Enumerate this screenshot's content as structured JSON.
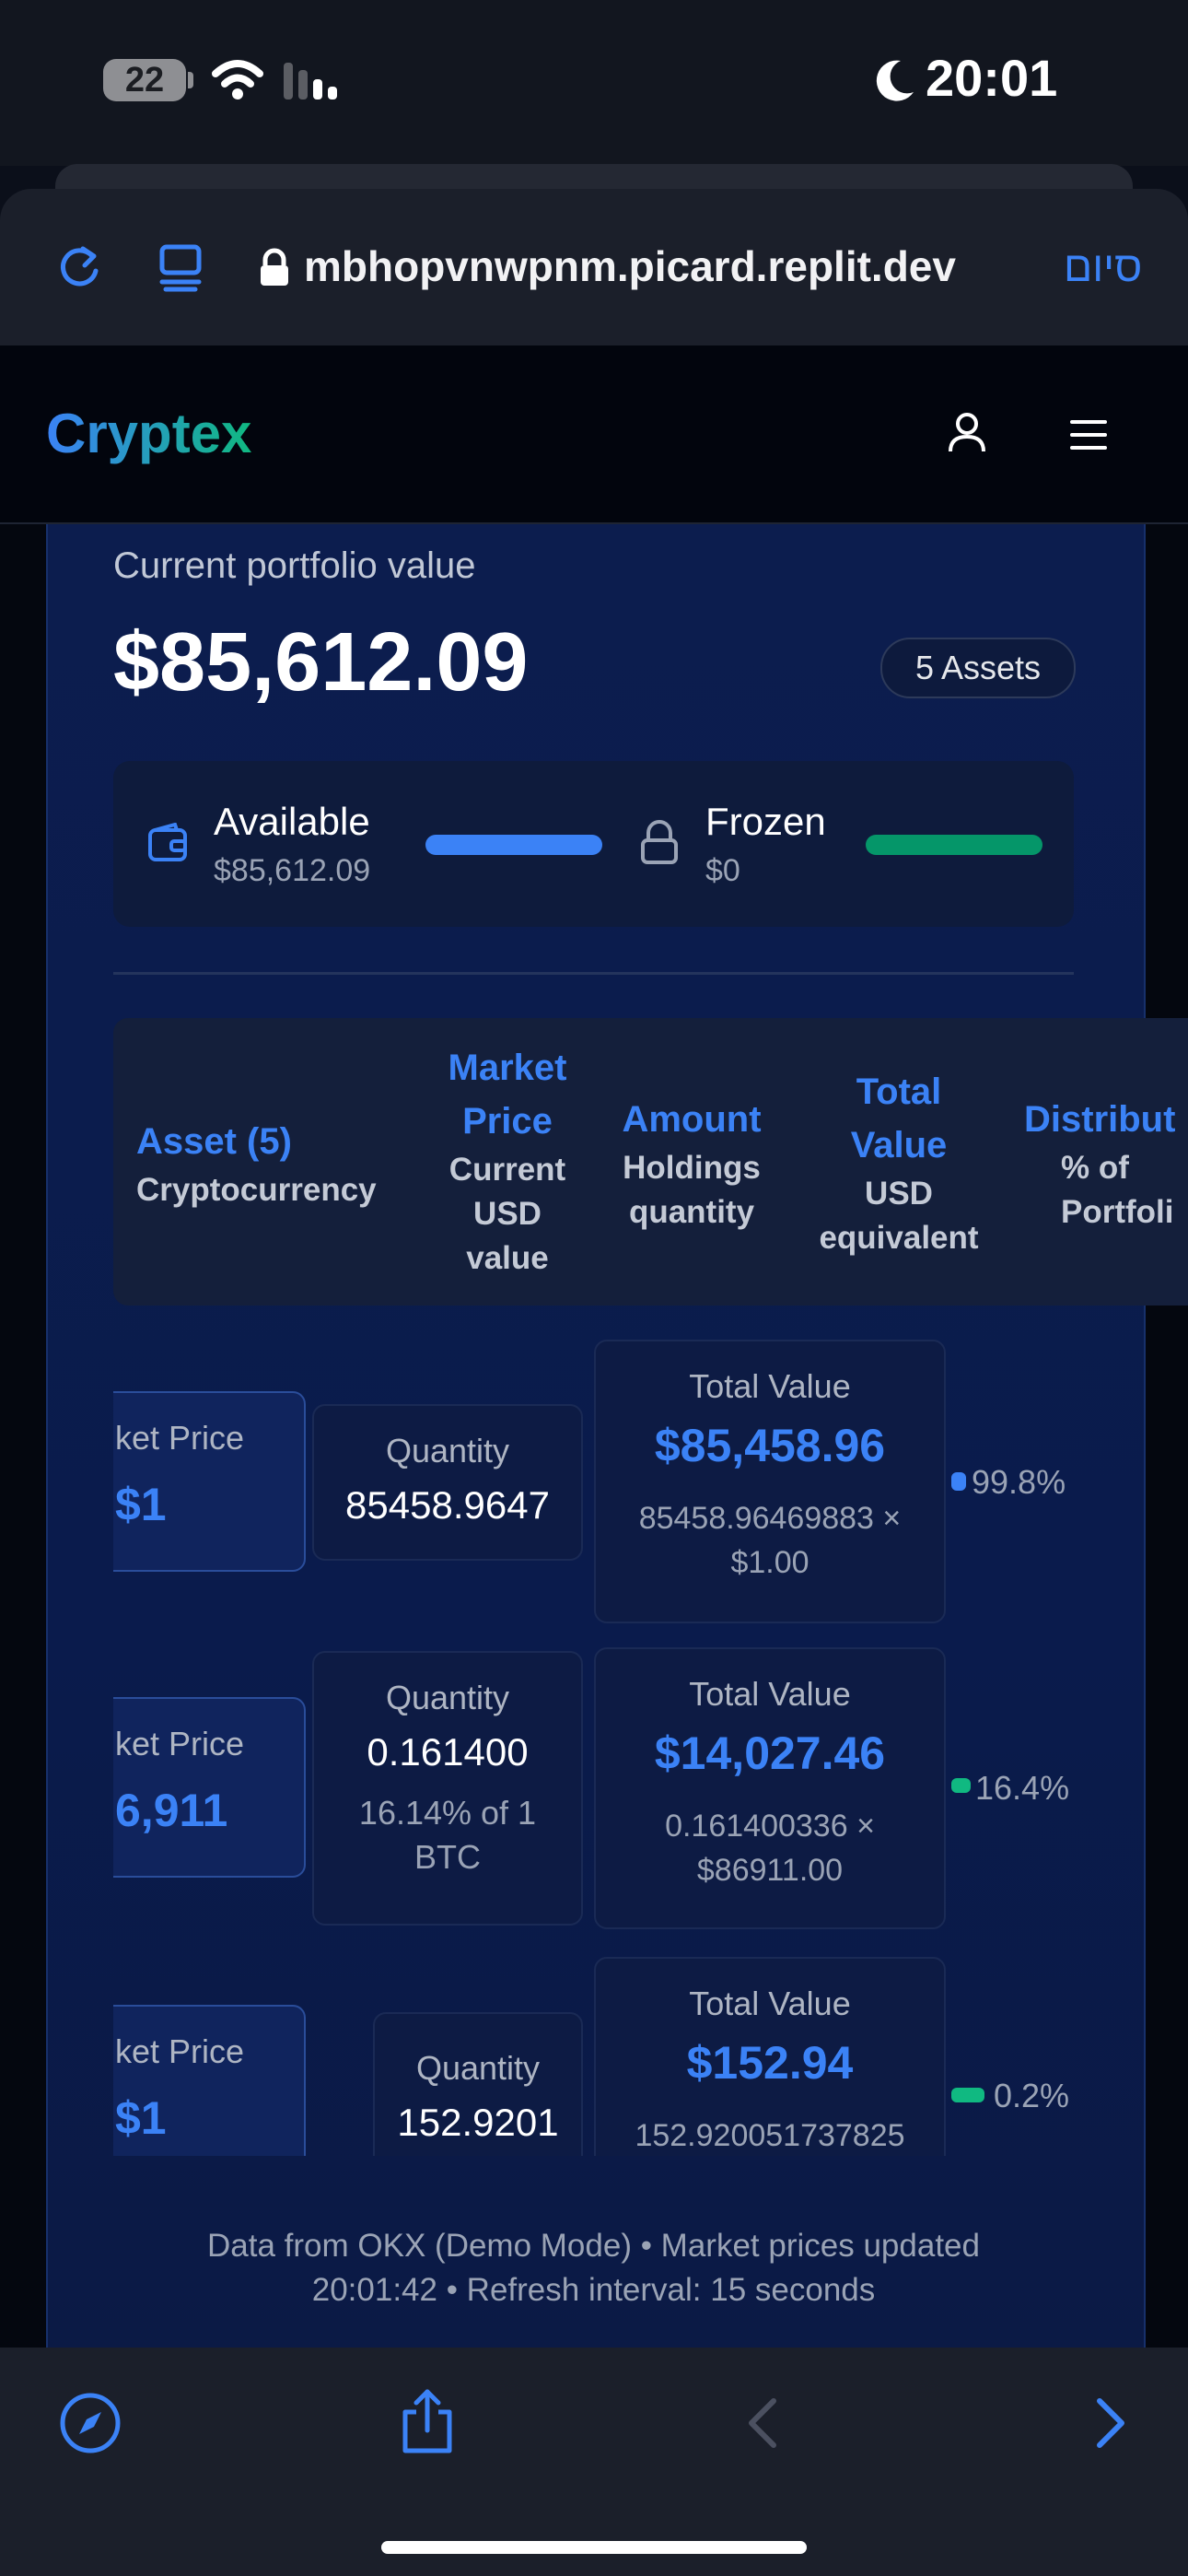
{
  "status_bar": {
    "battery": "22",
    "time": "20:01"
  },
  "browser": {
    "url": "mbhopvnwpnm.picard.replit.dev",
    "done_label": "סיום"
  },
  "app": {
    "logo": "Cryptex"
  },
  "portfolio": {
    "label": "Current portfolio value",
    "value": "$85,612.09",
    "assets_badge": "5 Assets",
    "available": {
      "title": "Available",
      "amount": "$85,612.09"
    },
    "frozen": {
      "title": "Frozen",
      "amount": "$0"
    }
  },
  "table": {
    "headers": [
      {
        "title": "Asset (5)",
        "sub": "Cryptocurrency"
      },
      {
        "title": "Market Price",
        "sub": "Current USD value"
      },
      {
        "title": "Amount",
        "sub": "Holdings quantity"
      },
      {
        "title": "Total Value",
        "sub": "USD equivalent"
      },
      {
        "title": "Distribut",
        "sub": "% of Portfoli"
      }
    ],
    "rows": [
      {
        "market_price_label": "ket Price",
        "market_price": "$1",
        "quantity_label": "Quantity",
        "quantity": "85458.9647",
        "quantity_note": "",
        "total_label": "Total Value",
        "total_value": "$85,458.96",
        "calc": "85458.96469883 × $1.00",
        "distribution": "99.8%",
        "dist_fraction": 0.998
      },
      {
        "market_price_label": "ket Price",
        "market_price": "6,911",
        "quantity_label": "Quantity",
        "quantity": "0.161400",
        "quantity_note": "16.14% of 1 BTC",
        "total_label": "Total Value",
        "total_value": "$14,027.46",
        "calc": "0.161400336 × $86911.00",
        "distribution": "16.4%",
        "dist_fraction": 0.164
      },
      {
        "market_price_label": "ket Price",
        "market_price": "$1",
        "quantity_label": "Quantity",
        "quantity": "152.9201",
        "quantity_note": "",
        "total_label": "Total Value",
        "total_value": "$152.94",
        "calc": "152.920051737825",
        "distribution": "0.2%",
        "dist_fraction": 0.002
      }
    ]
  },
  "footer": {
    "line1": "Data from OKX (Demo Mode) • Market prices updated",
    "line2": "20:01:42 • Refresh interval: 15 seconds"
  },
  "colors": {
    "accent": "#3b82f6",
    "green": "#10b981",
    "card": "#0c1d4e"
  }
}
